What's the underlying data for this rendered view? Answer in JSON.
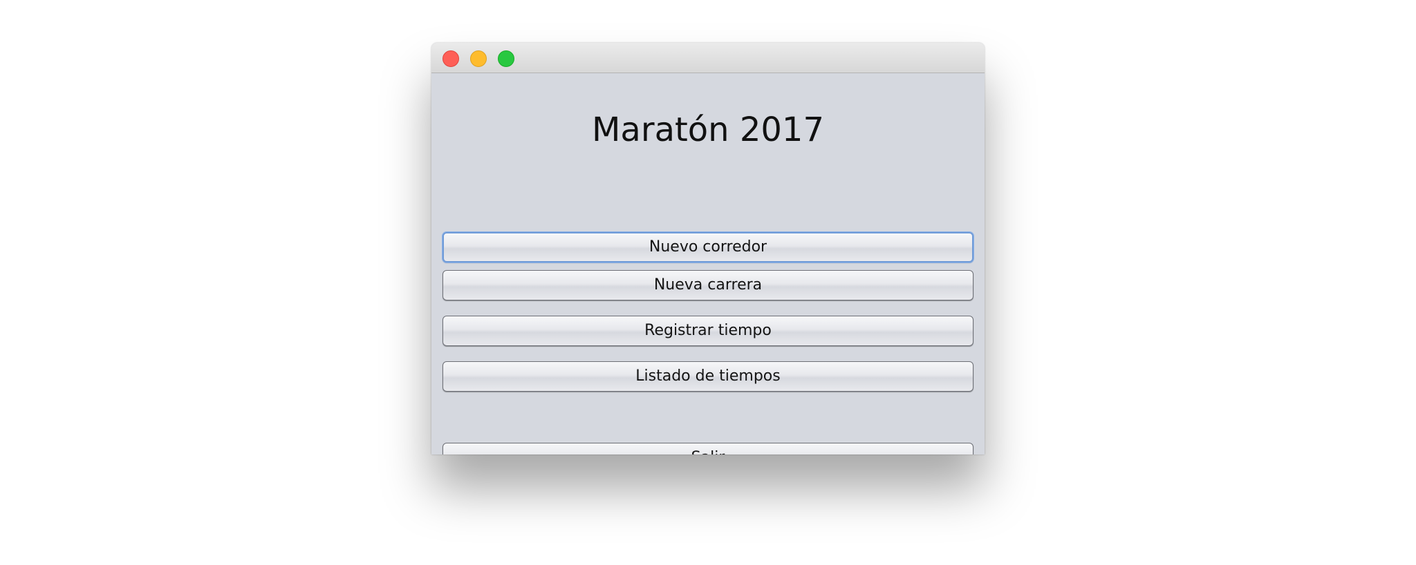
{
  "window": {
    "title": ""
  },
  "app": {
    "title": "Maratón 2017"
  },
  "menu": {
    "buttons": [
      {
        "label": "Nuevo corredor",
        "focused": true
      },
      {
        "label": "Nueva carrera"
      },
      {
        "label": "Registrar tiempo"
      },
      {
        "label": "Listado de tiempos"
      }
    ],
    "exit_label": "Salir"
  },
  "colors": {
    "window_bg": "#d5d8df",
    "close": "#fe5f57",
    "minimize": "#febc2e",
    "zoom": "#28c840",
    "focus_ring": "#6f9bd8"
  }
}
